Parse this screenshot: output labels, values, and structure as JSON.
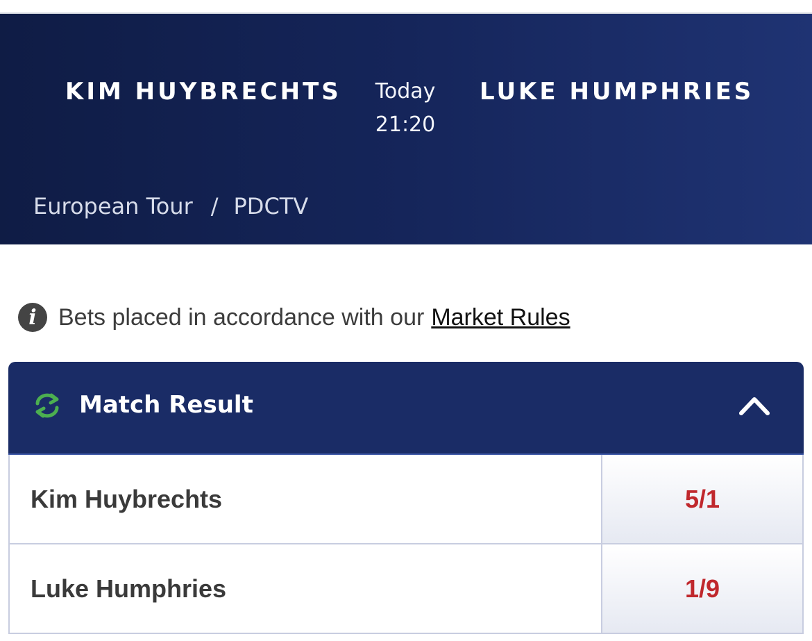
{
  "event": {
    "home_team": "KIM HUYBRECHTS",
    "away_team": "LUKE HUMPHRIES",
    "day": "Today",
    "time": "21:20",
    "breadcrumb": [
      "European Tour",
      "PDCTV"
    ],
    "breadcrumb_separator": "/"
  },
  "rules_notice": {
    "icon": "info-icon",
    "text": "Bets placed in accordance with our",
    "link_label": "Market Rules"
  },
  "market": {
    "title": "Match Result",
    "icon": "refresh-icon",
    "icon_color": "#4caf50",
    "collapse_icon": "chevron-up-icon",
    "selections": [
      {
        "name": "Kim Huybrechts",
        "odds": "5/1"
      },
      {
        "name": "Luke Humphries",
        "odds": "1/9"
      }
    ]
  },
  "colors": {
    "hero_bg": "#15255a",
    "market_header_bg": "#1a2c66",
    "odds_text": "#c0282d"
  }
}
